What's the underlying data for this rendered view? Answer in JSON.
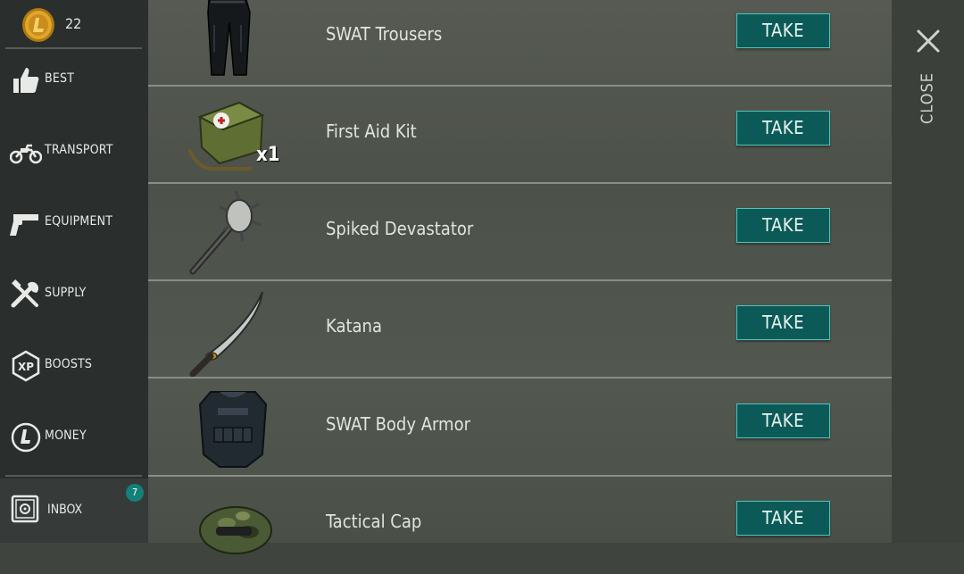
{
  "currency": {
    "amount": "22",
    "icon": "coin-icon"
  },
  "sidebar": {
    "items": [
      {
        "label": "BEST",
        "icon": "thumbs-up-icon"
      },
      {
        "label": "TRANSPORT",
        "icon": "motorcycle-icon"
      },
      {
        "label": "EQUIPMENT",
        "icon": "pistol-icon"
      },
      {
        "label": "SUPPLY",
        "icon": "tools-icon"
      },
      {
        "label": "BOOSTS",
        "icon": "xp-icon"
      },
      {
        "label": "MONEY",
        "icon": "money-coin-icon"
      }
    ],
    "inbox": {
      "label": "INBOX",
      "badge": "7",
      "icon": "safe-icon"
    }
  },
  "items": [
    {
      "name": "SWAT Trousers",
      "button": "TAKE",
      "icon": "trousers-icon"
    },
    {
      "name": "First Aid Kit",
      "button": "TAKE",
      "icon": "first-aid-kit-icon",
      "quantity": "x1"
    },
    {
      "name": "Spiked Devastator",
      "button": "TAKE",
      "icon": "spiked-club-icon"
    },
    {
      "name": "Katana",
      "button": "TAKE",
      "icon": "katana-icon"
    },
    {
      "name": "SWAT Body Armor",
      "button": "TAKE",
      "icon": "body-armor-icon"
    },
    {
      "name": "Tactical Cap",
      "button": "TAKE",
      "icon": "tactical-cap-icon"
    }
  ],
  "close": {
    "label": "CLOSE",
    "icon": "close-icon"
  },
  "colors": {
    "accent": "#0c5a57",
    "accent_border": "#4fc6bc",
    "badge": "#13807a"
  }
}
